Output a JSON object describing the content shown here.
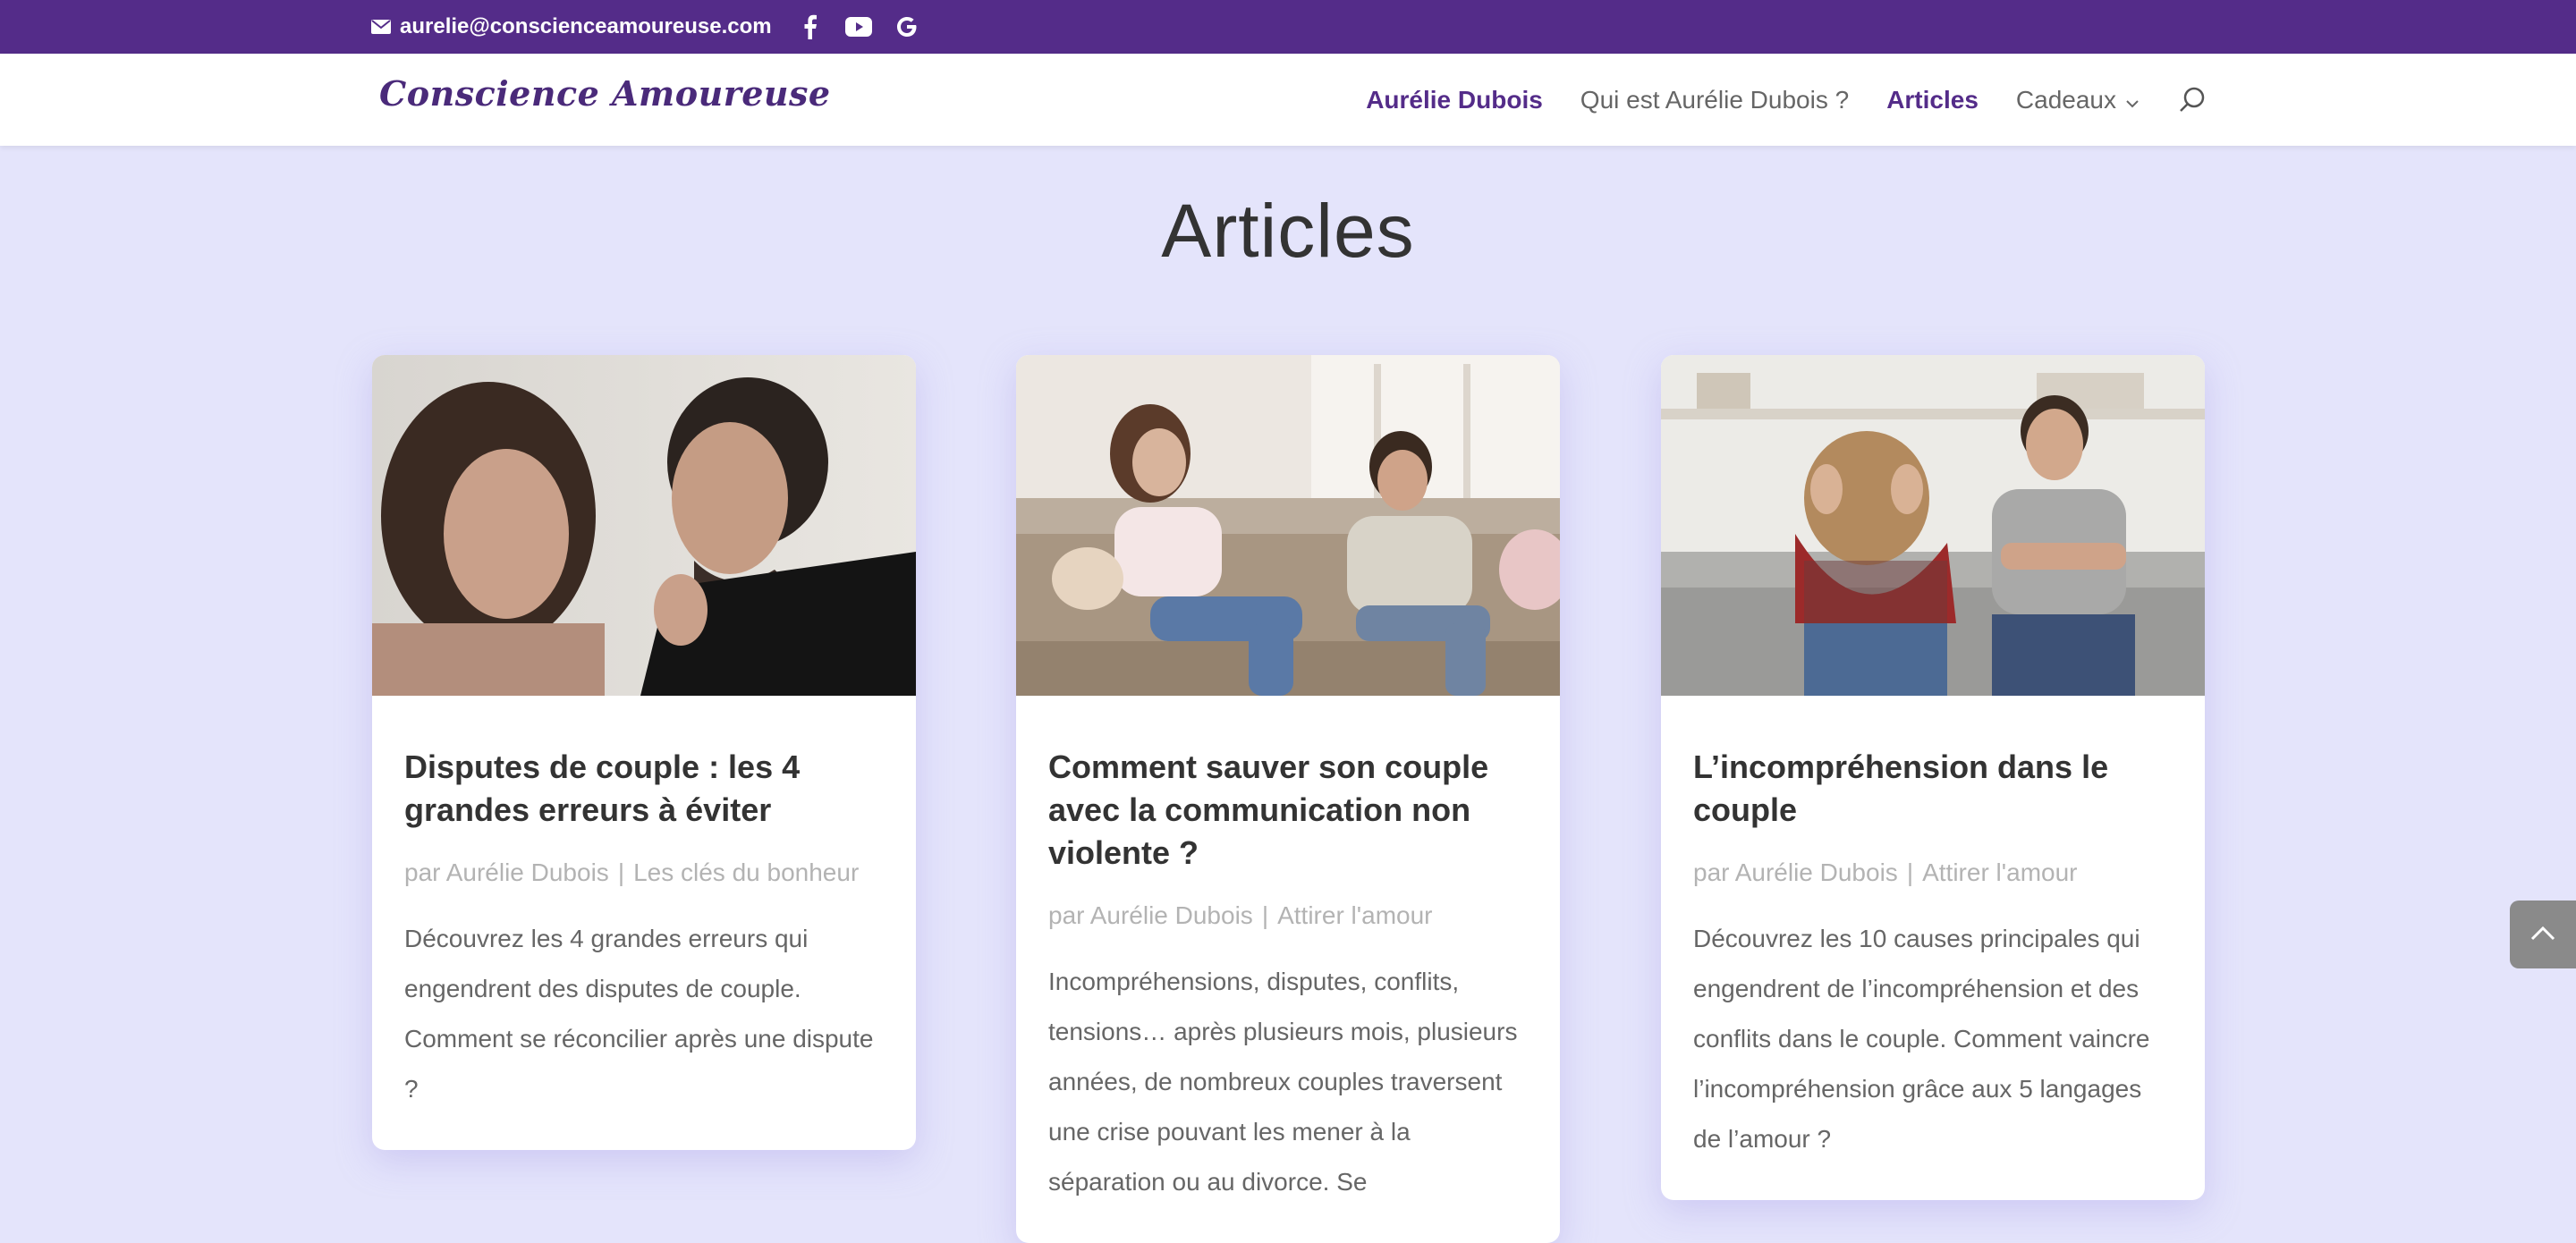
{
  "topbar": {
    "email": "aurelie@conscienceamoureuse.com",
    "social": [
      "facebook-icon",
      "youtube-icon",
      "google-icon"
    ]
  },
  "header": {
    "logo": "Conscience Amoureuse",
    "nav": [
      {
        "label": "Aurélie Dubois",
        "active": true
      },
      {
        "label": "Qui est Aurélie Dubois ?",
        "active": false
      },
      {
        "label": "Articles",
        "active": true
      },
      {
        "label": "Cadeaux",
        "active": false,
        "dropdown": true
      }
    ]
  },
  "page": {
    "title": "Articles"
  },
  "articles": [
    {
      "title": "Disputes de couple : les 4 grandes erreurs à éviter",
      "author": "par Aurélie Dubois",
      "category": "Les clés du bonheur",
      "excerpt": "Découvrez les 4 grandes erreurs qui engendrent des disputes de couple. Comment se réconcilier après une dispute ?"
    },
    {
      "title": "Comment sauver son couple avec la communication non violente ?",
      "author": "par Aurélie Dubois",
      "category": "Attirer l'amour",
      "excerpt": "Incompréhensions, disputes, conflits, tensions… après plusieurs mois, plusieurs années, de nombreux couples traversent une crise pouvant les mener à la séparation ou au divorce. Se"
    },
    {
      "title": "L’incompréhension dans le couple",
      "author": "par Aurélie Dubois",
      "category": "Attirer l'amour",
      "excerpt": "Découvrez les 10 causes principales qui engendrent de l’incompréhension et des conflits dans le couple. Comment vaincre l’incompréhension grâce aux 5 langages de l’amour ?"
    }
  ],
  "colors": {
    "topbar": "#542c89",
    "background": "#e4e4fb",
    "accent": "#542c89"
  }
}
